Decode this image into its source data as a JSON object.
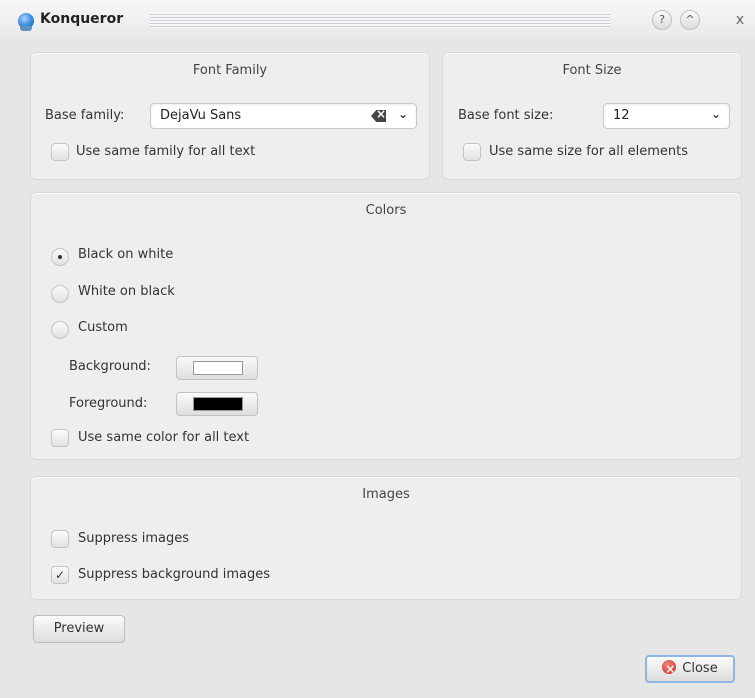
{
  "window": {
    "title": "Konqueror",
    "help_glyph": "?",
    "shade_glyph": "^",
    "close_glyph": "x"
  },
  "font_family": {
    "title": "Font Family",
    "base_family_label": "Base family:",
    "base_family_value": "DejaVu Sans",
    "same_family_label": "Use same family for all text",
    "same_family_checked": false
  },
  "font_size": {
    "title": "Font Size",
    "base_size_label": "Base font size:",
    "base_size_value": "12",
    "same_size_label": "Use same size for all elements",
    "same_size_checked": false
  },
  "colors": {
    "title": "Colors",
    "options": [
      {
        "label": "Black on white",
        "selected": true
      },
      {
        "label": "White on black",
        "selected": false
      },
      {
        "label": "Custom",
        "selected": false
      }
    ],
    "background_label": "Background:",
    "background_color": "#ffffff",
    "foreground_label": "Foreground:",
    "foreground_color": "#000000",
    "same_color_label": "Use same color for all text",
    "same_color_checked": false
  },
  "images": {
    "title": "Images",
    "suppress_images_label": "Suppress images",
    "suppress_images_checked": false,
    "suppress_bg_label": "Suppress background images",
    "suppress_bg_checked": true,
    "check_glyph": "✓"
  },
  "buttons": {
    "preview": "Preview",
    "close": "Close"
  }
}
